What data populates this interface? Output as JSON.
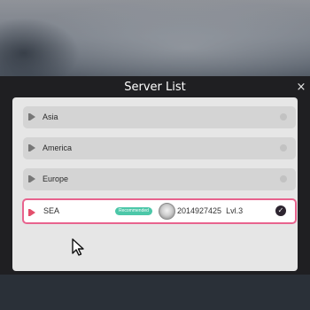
{
  "dialog": {
    "title": "Server List",
    "close_label": "×"
  },
  "servers": [
    {
      "name": "Asia",
      "selected": false
    },
    {
      "name": "America",
      "selected": false
    },
    {
      "name": "Europe",
      "selected": false
    },
    {
      "name": "SEA",
      "selected": true,
      "badge": "Recommended",
      "account_id": "2014927425",
      "level": "Lvl.3"
    }
  ],
  "colors": {
    "selected_border": "#e8638e",
    "badge": "#4cc7a8",
    "row_bg": "#d4d4d4",
    "panel_bg": "#1f1f22"
  },
  "icons": {
    "flag": "flag-icon",
    "radio": "radio-empty-icon",
    "check": "checkmark-icon",
    "avatar": "avatar",
    "cursor": "mouse-cursor"
  }
}
